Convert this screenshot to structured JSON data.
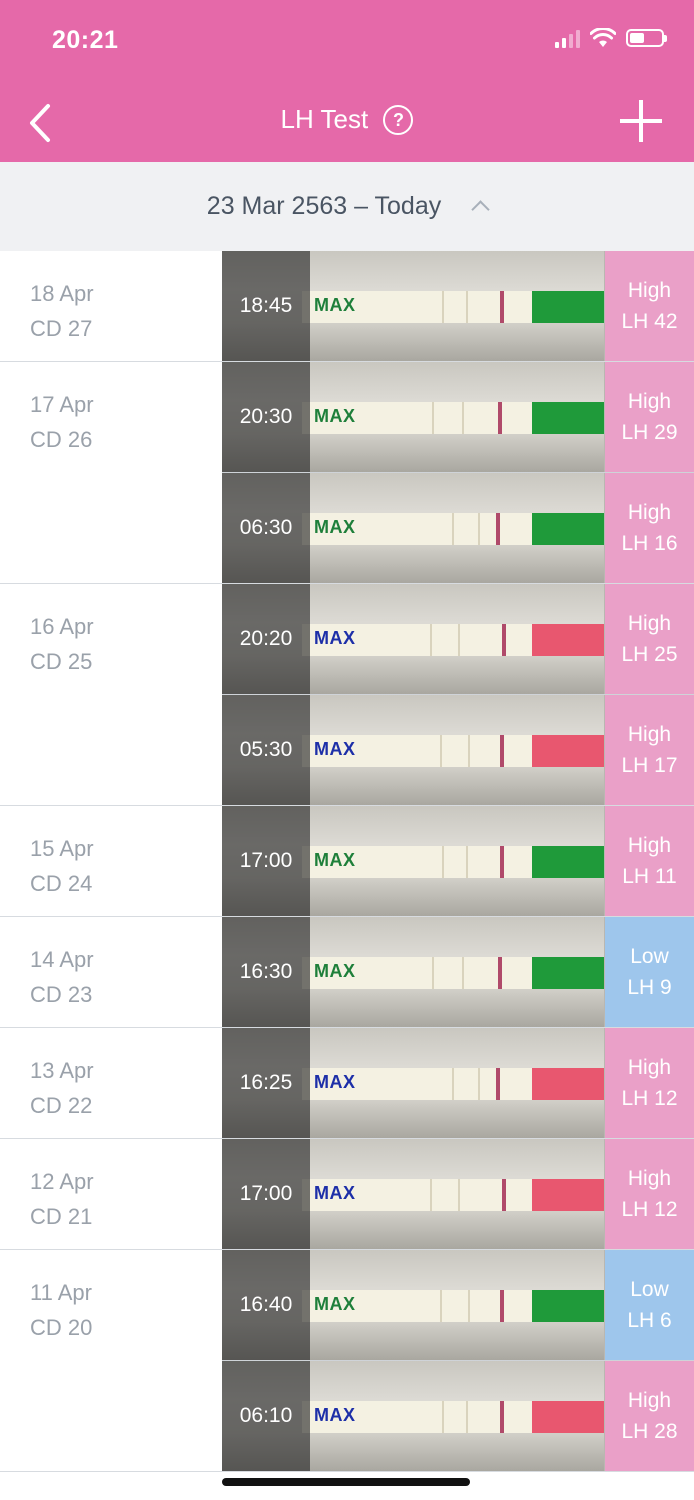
{
  "status_bar": {
    "time": "20:21"
  },
  "header": {
    "title": "LH Test",
    "help_glyph": "?"
  },
  "date_range": {
    "label": "23 Mar 2563 – Today"
  },
  "colors": {
    "brand": "#e569a9",
    "high": "#eaa0c8",
    "low": "#9ec6ec",
    "strip_green": "#1f9a3a",
    "strip_pink": "#e8576f",
    "max_green": "#1e7f3a",
    "max_blue": "#1d2fa8"
  },
  "groups": [
    {
      "date": "18 Apr",
      "cd": "CD 27",
      "entries": [
        {
          "time": "18:45",
          "level": "High",
          "lh": "LH 42",
          "max": "MAX",
          "cap": "green"
        }
      ]
    },
    {
      "date": "17 Apr",
      "cd": "CD 26",
      "entries": [
        {
          "time": "20:30",
          "level": "High",
          "lh": "LH 29",
          "max": "MAX",
          "cap": "green"
        },
        {
          "time": "06:30",
          "level": "High",
          "lh": "LH 16",
          "max": "MAX",
          "cap": "green"
        }
      ]
    },
    {
      "date": "16 Apr",
      "cd": "CD 25",
      "entries": [
        {
          "time": "20:20",
          "level": "High",
          "lh": "LH 25",
          "max": "MAX",
          "cap": "pink"
        },
        {
          "time": "05:30",
          "level": "High",
          "lh": "LH 17",
          "max": "MAX",
          "cap": "pink"
        }
      ]
    },
    {
      "date": "15 Apr",
      "cd": "CD 24",
      "entries": [
        {
          "time": "17:00",
          "level": "High",
          "lh": "LH 11",
          "max": "MAX",
          "cap": "green"
        }
      ]
    },
    {
      "date": "14 Apr",
      "cd": "CD 23",
      "entries": [
        {
          "time": "16:30",
          "level": "Low",
          "lh": "LH 9",
          "max": "MAX",
          "cap": "green"
        }
      ]
    },
    {
      "date": "13 Apr",
      "cd": "CD 22",
      "entries": [
        {
          "time": "16:25",
          "level": "High",
          "lh": "LH 12",
          "max": "MAX",
          "cap": "pink"
        }
      ]
    },
    {
      "date": "12 Apr",
      "cd": "CD 21",
      "entries": [
        {
          "time": "17:00",
          "level": "High",
          "lh": "LH 12",
          "max": "MAX",
          "cap": "pink"
        }
      ]
    },
    {
      "date": "11 Apr",
      "cd": "CD 20",
      "entries": [
        {
          "time": "16:40",
          "level": "Low",
          "lh": "LH 6",
          "max": "MAX",
          "cap": "green"
        },
        {
          "time": "06:10",
          "level": "High",
          "lh": "LH 28",
          "max": "MAX",
          "cap": "pink"
        }
      ]
    }
  ]
}
